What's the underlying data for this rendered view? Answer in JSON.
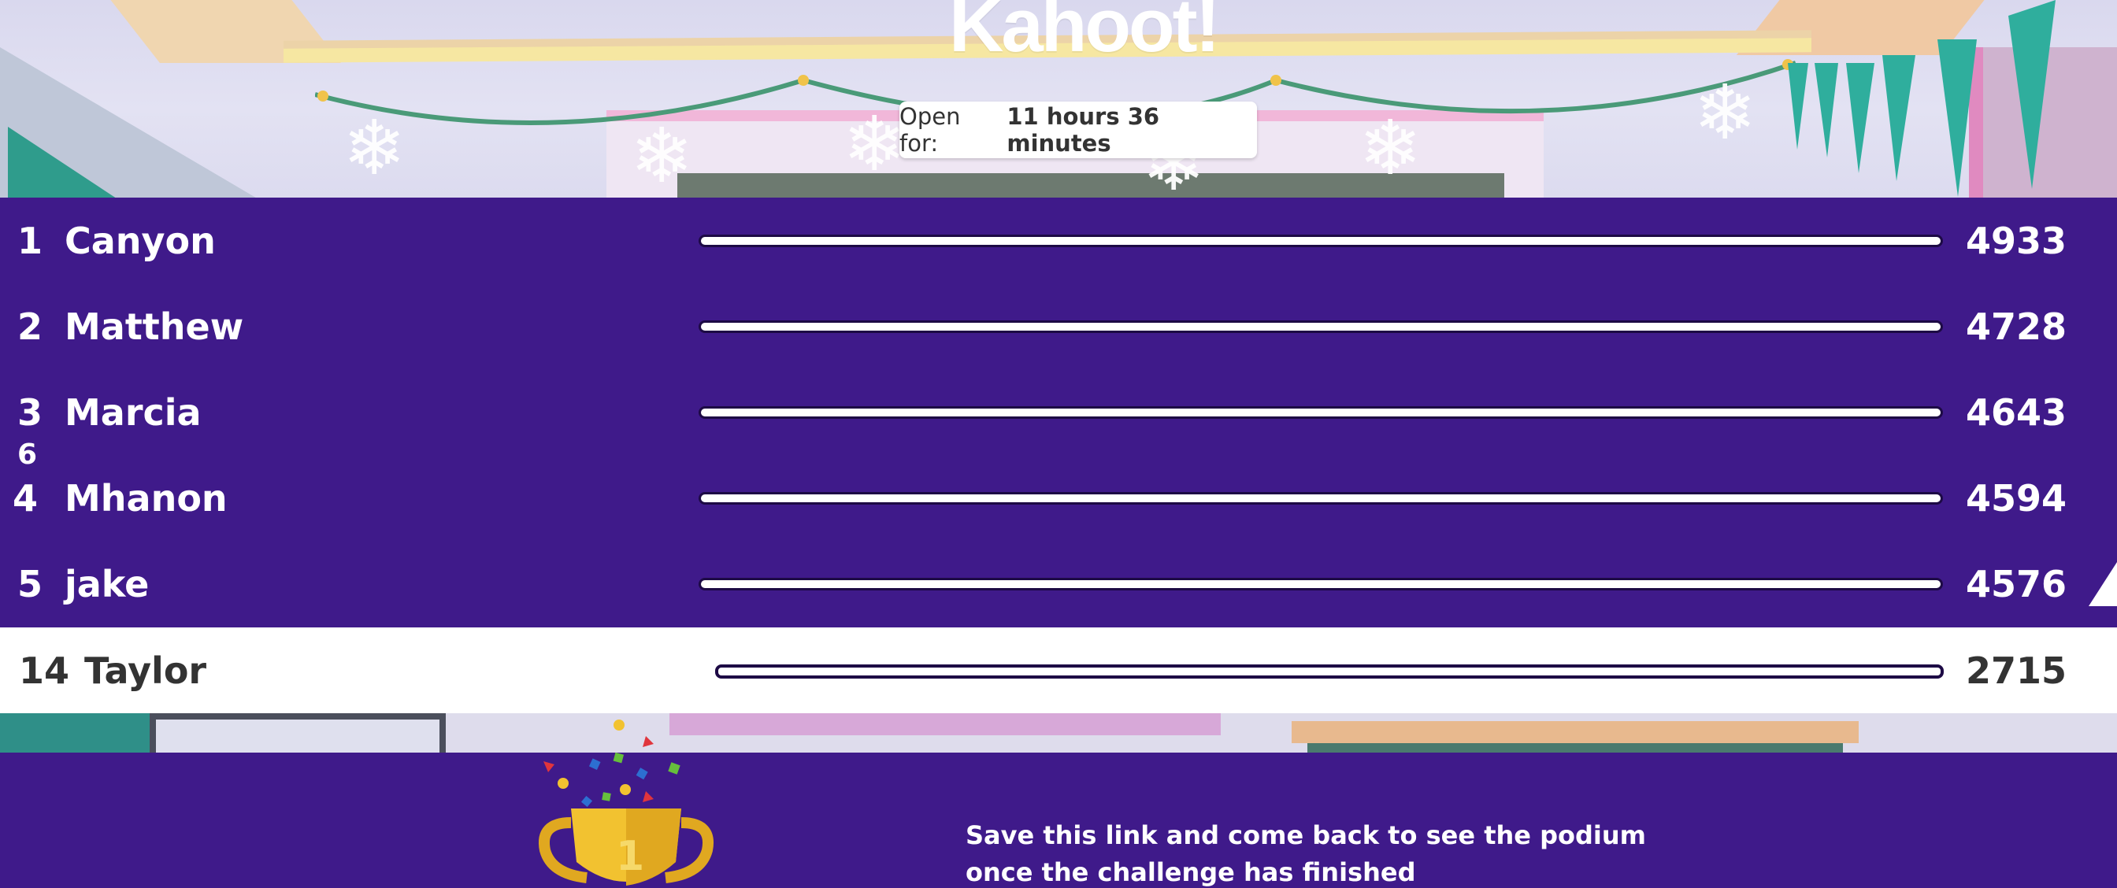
{
  "brand": {
    "logo_text": "Kahoot!"
  },
  "timer": {
    "prefix": "Open for:",
    "value": "11 hours 36 minutes"
  },
  "leaderboard": {
    "rows": [
      {
        "rank": "1",
        "name": "Canyon",
        "score": "4933"
      },
      {
        "rank": "2",
        "name": "Matthew",
        "score": "4728"
      },
      {
        "rank": "3",
        "name": "Marcia",
        "score": "4643"
      },
      {
        "rank": "4",
        "name": "Mhanon",
        "score": "4594"
      },
      {
        "rank": "5",
        "name": "jake",
        "score": "4576"
      }
    ],
    "transition_rank": "6",
    "current_player": {
      "rank": "14",
      "name": "Taylor",
      "score": "2715"
    }
  },
  "footer": {
    "message_line1": "Save this link and come back to see the podium",
    "message_line2": "once the challenge has finished",
    "trophy_number": "1"
  },
  "colors": {
    "brand_purple": "#3f1a8a",
    "bar_outline": "#1d0a45",
    "trophy_gold": "#f2c230"
  }
}
